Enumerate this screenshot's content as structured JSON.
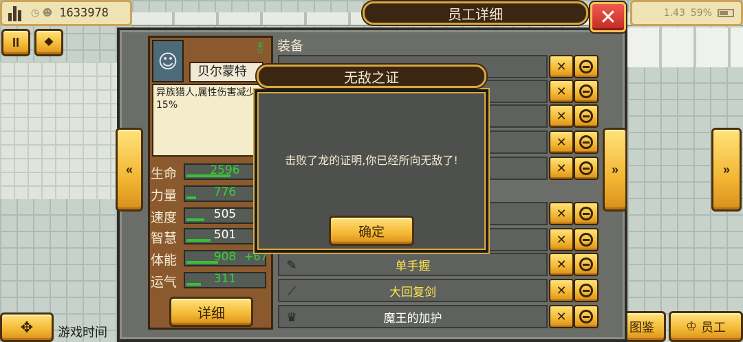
{
  "hud": {
    "money": "1633978",
    "battery_percent": "59%",
    "net_speed": "1.43"
  },
  "window": {
    "title": "员工详细",
    "close_glyph": "✕"
  },
  "controls": {
    "pause_glyph": "II",
    "speed_glyph": "⯁",
    "prev_glyph": "«",
    "next_glyph": "»",
    "compass_glyph": "✥",
    "game_time_label": "游戏时间",
    "codex_label": "图鉴",
    "staff_label": "员工"
  },
  "character": {
    "name": "贝尔蒙特",
    "description": "异族猎人,属性伤害减少15%",
    "stats": [
      {
        "label": "生命",
        "value": "2596",
        "value_color": "#38d038",
        "fill": 0.55,
        "bonus": ""
      },
      {
        "label": "力量",
        "value": "776",
        "value_color": "#38d038",
        "fill": 0.12,
        "bonus": ""
      },
      {
        "label": "速度",
        "value": "505",
        "value_color": "#ffffff",
        "fill": 0.22,
        "bonus": ""
      },
      {
        "label": "智慧",
        "value": "501",
        "value_color": "#ffffff",
        "fill": 0.3,
        "bonus": ""
      },
      {
        "label": "体能",
        "value": "908",
        "value_color": "#38d038",
        "fill": 0.4,
        "bonus": "+67"
      },
      {
        "label": "运气",
        "value": "311",
        "value_color": "#38d038",
        "fill": 0.18,
        "bonus": ""
      }
    ],
    "detail_button": "详细"
  },
  "equipment": {
    "title": "装备",
    "items": [
      {
        "name": "",
        "color": "#e0a020",
        "icon": "—"
      },
      {
        "name": "",
        "color": "#e0a020",
        "icon": ""
      },
      {
        "name": "",
        "color": "#e0a020",
        "icon": ""
      },
      {
        "name": "",
        "color": "#e0a020",
        "icon": ""
      },
      {
        "name": "",
        "color": "#e0a020",
        "icon": ""
      },
      {
        "name": "",
        "color": "#ffe34a",
        "icon": ""
      },
      {
        "name": "",
        "color": "#ffe34a",
        "icon": ""
      },
      {
        "name": "单手握",
        "color": "#ffe34a",
        "icon": "✎"
      },
      {
        "name": "大回复剑",
        "color": "#ffe34a",
        "icon": "⟋"
      },
      {
        "name": "魔王的加护",
        "color": "#ffffff",
        "icon": "♛"
      }
    ]
  },
  "dialog": {
    "title": "无敌之证",
    "message": "击败了龙的证明,你已经所向无敌了!",
    "confirm": "确定"
  }
}
